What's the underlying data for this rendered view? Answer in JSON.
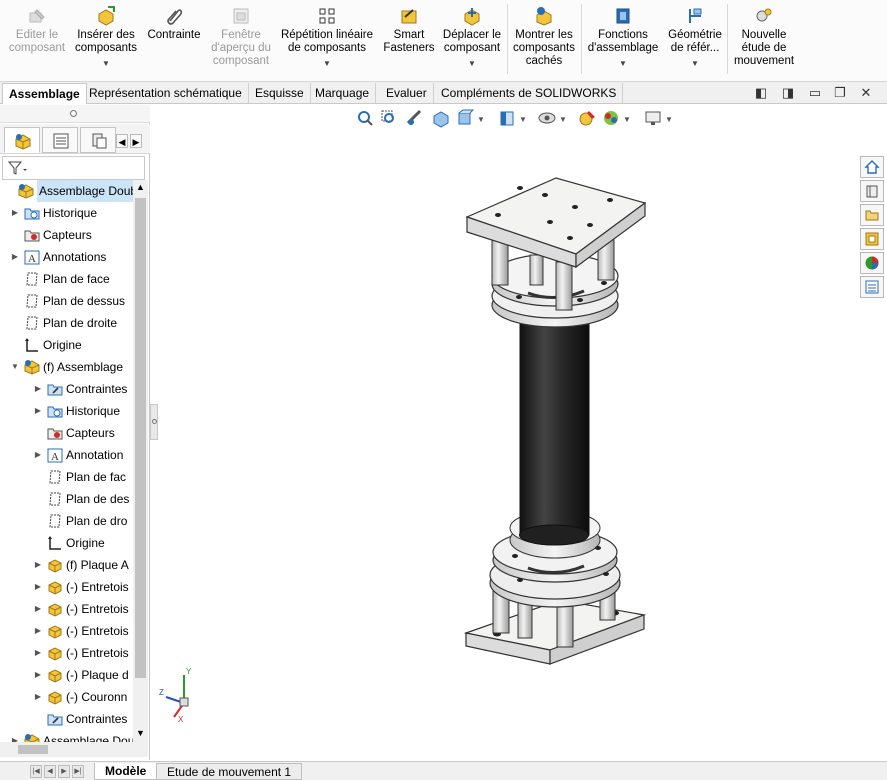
{
  "ribbon": {
    "buttons": [
      {
        "label": "Editer le composant",
        "disabled": true,
        "dropdown": false
      },
      {
        "label": "Insérer des composants",
        "disabled": false,
        "dropdown": true
      },
      {
        "label": "Contrainte",
        "disabled": false,
        "dropdown": false
      },
      {
        "label": "Fenêtre d'aperçu du composant",
        "disabled": true,
        "dropdown": false
      },
      {
        "label": "Répétition linéaire de composants",
        "disabled": false,
        "dropdown": true
      },
      {
        "label": "Smart Fasteners",
        "disabled": false,
        "dropdown": false
      },
      {
        "label": "Déplacer le composant",
        "disabled": false,
        "dropdown": true
      },
      {
        "label": "Montrer les composants cachés",
        "disabled": false,
        "dropdown": false
      },
      {
        "label": "Fonctions d'assemblage",
        "disabled": false,
        "dropdown": true
      },
      {
        "label": "Géométrie de référ...",
        "disabled": false,
        "dropdown": true
      },
      {
        "label": "Nouvelle étude de mouvement",
        "disabled": false,
        "dropdown": false
      }
    ]
  },
  "command_tabs": [
    "Assemblage",
    "Représentation schématique",
    "Esquisse",
    "Marquage",
    "Evaluer",
    "Compléments de SOLIDWORKS"
  ],
  "active_command_tab": "Assemblage",
  "window_controls": {
    "tile_h": "◧",
    "tile_v": "◨",
    "restore": "▭",
    "maximize": "❐",
    "close": "✕"
  },
  "tree": {
    "nodes": [
      {
        "label": "Assemblage Double",
        "icon": "assembly",
        "expander": "",
        "selected": true
      },
      {
        "label": "Historique",
        "icon": "history",
        "expander": "▶"
      },
      {
        "label": "Capteurs",
        "icon": "sensor",
        "expander": ""
      },
      {
        "label": "Annotations",
        "icon": "annotation",
        "expander": "▶"
      },
      {
        "label": "Plan de face",
        "icon": "plane",
        "expander": ""
      },
      {
        "label": "Plan de dessus",
        "icon": "plane",
        "expander": ""
      },
      {
        "label": "Plan de droite",
        "icon": "plane",
        "expander": ""
      },
      {
        "label": "Origine",
        "icon": "origin",
        "expander": ""
      },
      {
        "label": "(f) Assemblage",
        "icon": "assembly",
        "expander": "▼"
      },
      {
        "label": "Contraintes",
        "icon": "mates",
        "expander": "▶"
      },
      {
        "label": "Historique",
        "icon": "history",
        "expander": "▶"
      },
      {
        "label": "Capteurs",
        "icon": "sensor",
        "expander": ""
      },
      {
        "label": "Annotation",
        "icon": "annotation",
        "expander": "▶"
      },
      {
        "label": "Plan de fac",
        "icon": "plane",
        "expander": ""
      },
      {
        "label": "Plan de des",
        "icon": "plane",
        "expander": ""
      },
      {
        "label": "Plan de dro",
        "icon": "plane",
        "expander": ""
      },
      {
        "label": "Origine",
        "icon": "origin",
        "expander": ""
      },
      {
        "label": "(f) Plaque A",
        "icon": "part",
        "expander": "▶"
      },
      {
        "label": "(-) Entretois",
        "icon": "part",
        "expander": "▶"
      },
      {
        "label": "(-) Entretois",
        "icon": "part",
        "expander": "▶"
      },
      {
        "label": "(-) Entretois",
        "icon": "part",
        "expander": "▶"
      },
      {
        "label": "(-) Entretois",
        "icon": "part",
        "expander": "▶"
      },
      {
        "label": "(-) Plaque d",
        "icon": "part",
        "expander": "▶"
      },
      {
        "label": "(-) Couronn",
        "icon": "part",
        "expander": "▶"
      },
      {
        "label": "Contraintes",
        "icon": "mates",
        "expander": ""
      },
      {
        "label": "Assemblage Dou",
        "icon": "assembly",
        "expander": "▶"
      }
    ]
  },
  "bottom_tabs": [
    "Modèle",
    "Etude de mouvement 1"
  ],
  "active_bottom_tab": "Modèle",
  "triad": {
    "x": "X",
    "y": "Y",
    "z": "Z"
  },
  "colors": {
    "ribbon_bg": "#fbfbfb",
    "tube": "#2a2a2a",
    "plate": "#f3f3f1",
    "selection": "#cce4f7",
    "icon_yellow": "#f2c53d",
    "icon_blue": "#2a6db5"
  }
}
